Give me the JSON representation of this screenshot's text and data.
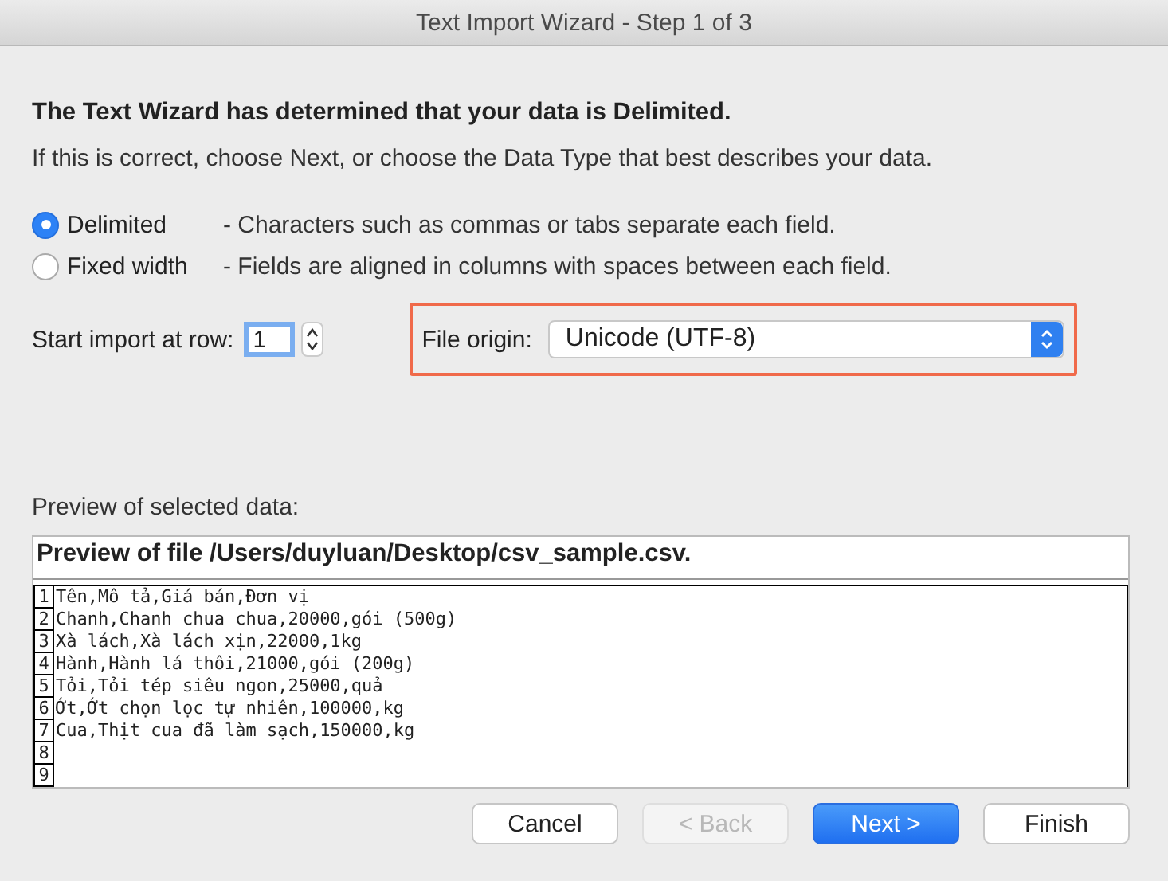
{
  "window": {
    "title": "Text Import Wizard - Step 1 of 3"
  },
  "heading": "The Text Wizard has determined that your data is Delimited.",
  "intro": "If this is correct, choose Next, or choose the Data Type that best describes your data.",
  "data_types": [
    {
      "label": "Delimited",
      "description": "- Characters such as commas or tabs separate each field.",
      "selected": true
    },
    {
      "label": "Fixed width",
      "description": "- Fields are aligned in columns with spaces between each field.",
      "selected": false
    }
  ],
  "start_row": {
    "label": "Start import at row:",
    "value": "1"
  },
  "file_origin": {
    "label": "File origin:",
    "value": "Unicode (UTF-8)",
    "highlighted": true
  },
  "preview": {
    "label": "Preview of selected data:",
    "title": "Preview of file /Users/duyluan/Desktop/csv_sample.csv.",
    "rows": [
      {
        "number": "1",
        "text": "Tên,Mô tả,Giá bán,Đơn vị"
      },
      {
        "number": "2",
        "text": "Chanh,Chanh chua chua,20000,gói (500g)"
      },
      {
        "number": "3",
        "text": "Xà lách,Xà lách xịn,22000,1kg"
      },
      {
        "number": "4",
        "text": "Hành,Hành lá thôi,21000,gói (200g)"
      },
      {
        "number": "5",
        "text": "Tỏi,Tỏi tép siêu ngon,25000,quả"
      },
      {
        "number": "6",
        "text": "Ớt,Ớt chọn lọc tự nhiên,100000,kg"
      },
      {
        "number": "7",
        "text": "Cua,Thịt cua đã làm sạch,150000,kg"
      },
      {
        "number": "8",
        "text": ""
      },
      {
        "number": "9",
        "text": ""
      }
    ]
  },
  "buttons": [
    {
      "label": "Cancel",
      "kind": "default",
      "disabled": false
    },
    {
      "label": "< Back",
      "kind": "default",
      "disabled": true
    },
    {
      "label": "Next >",
      "kind": "primary",
      "disabled": false
    },
    {
      "label": "Finish",
      "kind": "default",
      "disabled": false
    }
  ]
}
